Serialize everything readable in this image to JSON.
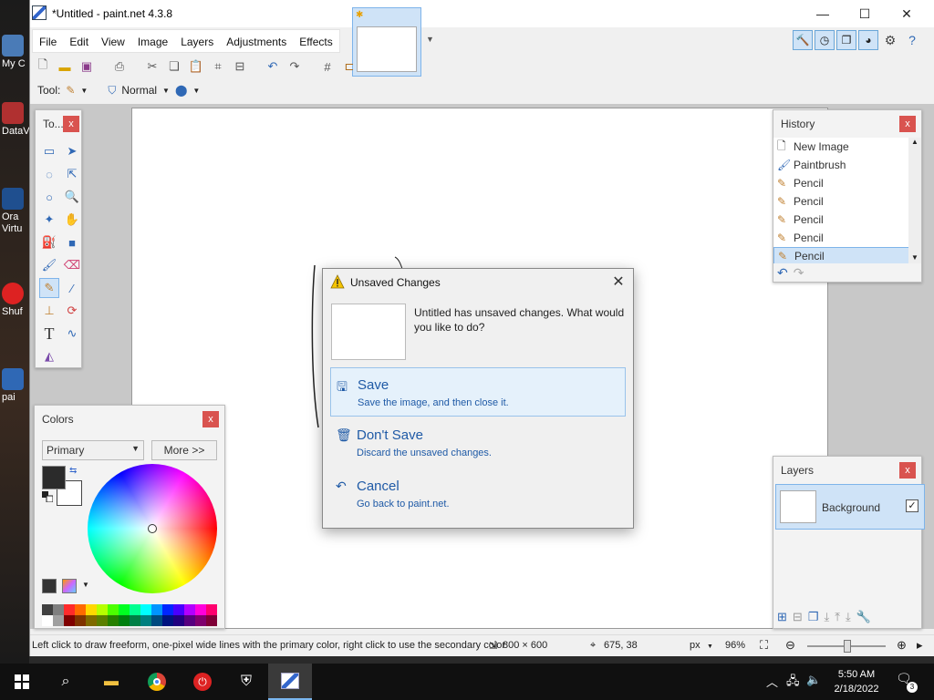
{
  "desktop": {
    "icons": [
      {
        "label": "My C"
      },
      {
        "label": "DataV"
      },
      {
        "label": "Ora Virtu"
      },
      {
        "label": "Shuf"
      },
      {
        "label": "pai"
      }
    ]
  },
  "window": {
    "title": "*Untitled - paint.net 4.3.8",
    "minimize": "—",
    "maximize": "☐",
    "close": "✕"
  },
  "menu": {
    "items": [
      "File",
      "Edit",
      "View",
      "Image",
      "Layers",
      "Adjustments",
      "Effects"
    ]
  },
  "toolbar2": {
    "tool_label": "Tool:",
    "blend_mode": "Normal"
  },
  "tools_panel": {
    "title": "To...",
    "close": "x"
  },
  "colors_panel": {
    "title": "Colors",
    "close": "x",
    "selector": "Primary",
    "more_button": "More >>",
    "primary_color": "#2b2b2b",
    "secondary_color": "#ffffff",
    "palette_row1": [
      "#404040",
      "#7f7f7f",
      "#ff2a2a",
      "#ff6a00",
      "#ffd800",
      "#b6ff00",
      "#4cff00",
      "#00ff21",
      "#00ff90",
      "#00ffff",
      "#0094ff",
      "#0026ff",
      "#4800ff",
      "#b200ff",
      "#ff00dc",
      "#ff006e"
    ],
    "palette_row2": [
      "#ffffff",
      "#a0a0a0",
      "#7f0000",
      "#7f3300",
      "#7f6a00",
      "#5b7f00",
      "#267f00",
      "#007f0e",
      "#007f46",
      "#007f7f",
      "#004a7f",
      "#00137f",
      "#21007f",
      "#57007f",
      "#7f006e",
      "#7f0037"
    ]
  },
  "history_panel": {
    "title": "History",
    "close": "x",
    "items": [
      {
        "label": "New Image",
        "icon": "new-image-icon"
      },
      {
        "label": "Paintbrush",
        "icon": "paintbrush-icon"
      },
      {
        "label": "Pencil",
        "icon": "pencil-icon"
      },
      {
        "label": "Pencil",
        "icon": "pencil-icon"
      },
      {
        "label": "Pencil",
        "icon": "pencil-icon"
      },
      {
        "label": "Pencil",
        "icon": "pencil-icon"
      },
      {
        "label": "Pencil",
        "icon": "pencil-icon"
      }
    ],
    "selected_index": 6
  },
  "layers_panel": {
    "title": "Layers",
    "close": "x",
    "layers": [
      {
        "name": "Background",
        "visible": true
      }
    ]
  },
  "dialog": {
    "title": "Unsaved Changes",
    "close": "✕",
    "message": "Untitled has unsaved changes. What would you like to do?",
    "options": [
      {
        "title": "Save",
        "desc": "Save the image, and then close it.",
        "icon": "save-icon"
      },
      {
        "title": "Don't Save",
        "desc": "Discard the unsaved changes.",
        "icon": "trash-icon"
      },
      {
        "title": "Cancel",
        "desc": "Go back to paint.net.",
        "icon": "undo-arrow-icon"
      }
    ]
  },
  "status": {
    "hint": "Left click to draw freeform, one-pixel wide lines with the primary color, right click to use the secondary color",
    "image_size": "800 × 600",
    "cursor_pos": "675, 38",
    "units": "px",
    "zoom": "96%"
  },
  "taskbar": {
    "time": "5:50 AM",
    "date": "2/18/2022",
    "notifications": "3"
  }
}
